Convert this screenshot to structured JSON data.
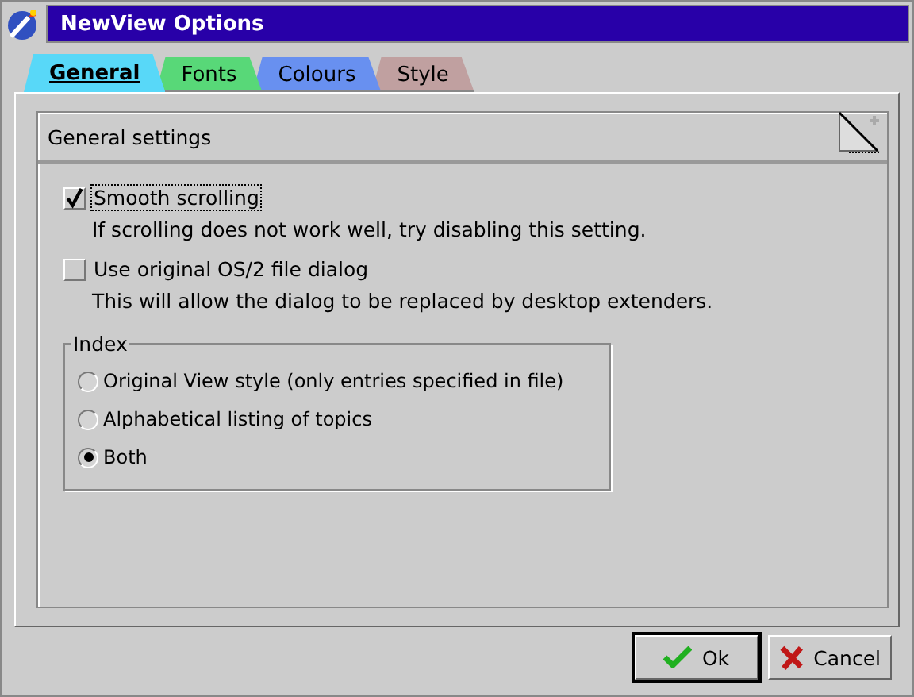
{
  "window": {
    "title": "NewView Options"
  },
  "tabs": [
    {
      "label": "General",
      "selected": true,
      "color": "#58d8f8"
    },
    {
      "label": "Fonts",
      "selected": false,
      "color": "#58d878"
    },
    {
      "label": "Colours",
      "selected": false,
      "color": "#6890f0"
    },
    {
      "label": "Style",
      "selected": false,
      "color": "#c0a0a0"
    }
  ],
  "page": {
    "heading": "General settings",
    "options": [
      {
        "label": "Smooth scrolling",
        "checked": true,
        "focused": true,
        "description": "If scrolling does not work well, try disabling this setting."
      },
      {
        "label": "Use original OS/2 file dialog",
        "checked": false,
        "focused": false,
        "description": "This will allow the dialog to be replaced by desktop extenders."
      }
    ],
    "index": {
      "title": "Index",
      "choices": [
        {
          "label": "Original View style (only entries specified in file)",
          "selected": false
        },
        {
          "label": "Alphabetical listing of topics",
          "selected": false
        },
        {
          "label": "Both",
          "selected": true
        }
      ]
    }
  },
  "buttons": [
    {
      "kind": "ok",
      "label": "Ok",
      "default": true
    },
    {
      "kind": "cancel",
      "label": "Cancel",
      "default": false
    }
  ]
}
